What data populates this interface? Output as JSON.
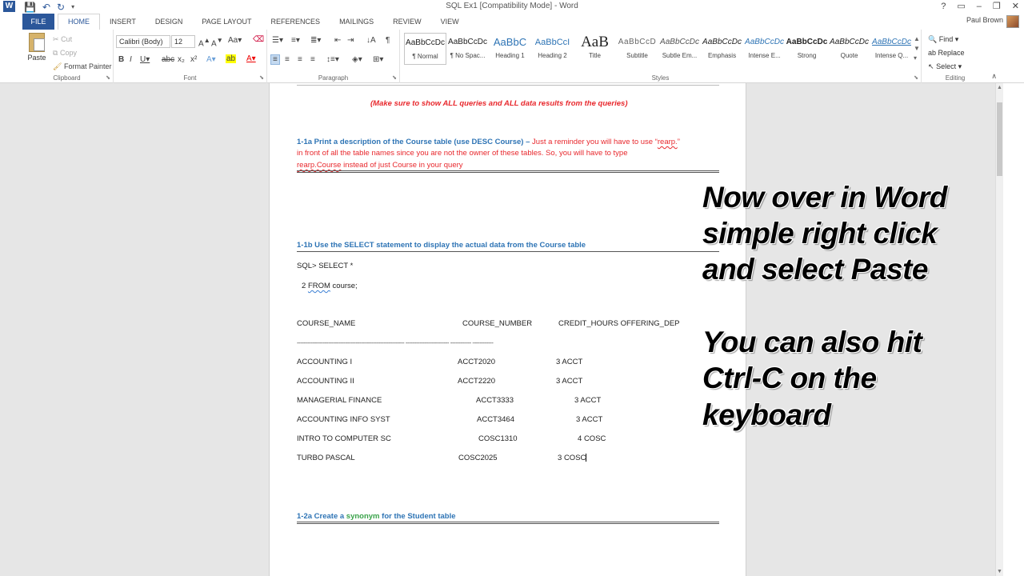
{
  "window": {
    "title": "SQL Ex1 [Compatibility Mode] - Word",
    "app_logo": "W",
    "controls": [
      "?",
      "▭",
      "–",
      "❐",
      "✕"
    ]
  },
  "ribbon_tabs": {
    "file": "FILE",
    "tabs": [
      "HOME",
      "INSERT",
      "DESIGN",
      "PAGE LAYOUT",
      "REFERENCES",
      "MAILINGS",
      "REVIEW",
      "VIEW"
    ],
    "active": "HOME",
    "user_name": "Paul Brown"
  },
  "clipboard": {
    "paste": "Paste",
    "cut": "Cut",
    "copy": "Copy",
    "format_painter": "Format Painter",
    "label": "Clipboard"
  },
  "font": {
    "family": "Calibri (Body)",
    "size": "12",
    "label": "Font"
  },
  "paragraph": {
    "label": "Paragraph"
  },
  "styles": {
    "label": "Styles",
    "items": [
      {
        "preview": "AaBbCcDc",
        "name": "¶ Normal"
      },
      {
        "preview": "AaBbCcDc",
        "name": "¶ No Spac..."
      },
      {
        "preview": "AaBbC",
        "name": "Heading 1"
      },
      {
        "preview": "AaBbCcI",
        "name": "Heading 2"
      },
      {
        "preview": "AaB",
        "name": "Title"
      },
      {
        "preview": "AaBbCcD",
        "name": "Subtitle"
      },
      {
        "preview": "AaBbCcDc",
        "name": "Subtle Em..."
      },
      {
        "preview": "AaBbCcDc",
        "name": "Emphasis"
      },
      {
        "preview": "AaBbCcDc",
        "name": "Intense E..."
      },
      {
        "preview": "AaBbCcDc",
        "name": "Strong"
      },
      {
        "preview": "AaBbCcDc",
        "name": "Quote"
      },
      {
        "preview": "AaBbCcDc",
        "name": "Intense Q..."
      }
    ]
  },
  "editing": {
    "label": "Editing",
    "find": "Find",
    "replace": "Replace",
    "select": "Select"
  },
  "document": {
    "note": "(Make sure to show ALL queries and ALL data results from the queries)",
    "q1a_title": "1-1a Print a description of the Course table (use DESC Course) –",
    "q1a_text1": " Just a reminder you will have to use “",
    "q1a_rearp": "rearp.",
    "q1a_text2": "”",
    "q1a_line2": "in front of all the table names since you are not the owner of these tables. So, you will have to type",
    "q1a_line3_link": "rearp.Course",
    "q1a_line3_rest": " instead of just Course in your query",
    "q1b_title": "1-1b Use the SELECT statement to display the actual data from the Course table",
    "sql_line1": "SQL> SELECT *",
    "sql_line2_num": "2  ",
    "sql_line2_from": "FROM",
    "sql_line2_rest": " course;",
    "headers": [
      "COURSE_NAME",
      "COURSE_NUMBER",
      "CREDIT_HOURS OFFERING_DEP"
    ],
    "separator": "-------------------------------------------------------------- ------------------------- ------------ ------------",
    "rows": [
      {
        "name": "ACCOUNTING I",
        "number": "ACCT2020",
        "hours": "3",
        "dep": "ACCT"
      },
      {
        "name": "ACCOUNTING II",
        "number": "ACCT2220",
        "hours": "3",
        "dep": "ACCT"
      },
      {
        "name": "MANAGERIAL FINANCE",
        "number": "ACCT3333",
        "hours": "3",
        "dep": "ACCT"
      },
      {
        "name": "ACCOUNTING INFO SYST",
        "number": "ACCT3464",
        "hours": "3",
        "dep": "ACCT"
      },
      {
        "name": "INTRO TO COMPUTER SC",
        "number": "COSC1310",
        "hours": "4",
        "dep": "COSC"
      },
      {
        "name": "TURBO PASCAL",
        "number": "COSC2025",
        "hours": "3",
        "dep": "COSC"
      }
    ],
    "q2a_pre": "1-2a Create a ",
    "q2a_synonym": "synonym",
    "q2a_post": " for the Student table"
  },
  "overlay_text": {
    "line1": "Now over in Word",
    "line2": "simple right click",
    "line3": "and select Paste",
    "line4": "You can also hit",
    "line5": "Ctrl-C on the",
    "line6": "keyboard"
  }
}
